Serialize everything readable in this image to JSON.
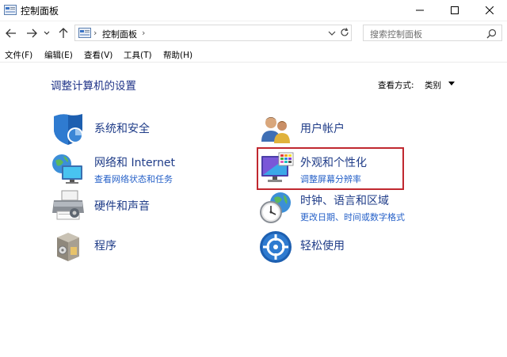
{
  "window": {
    "title": "控制面板"
  },
  "address": {
    "path": "控制面板"
  },
  "search": {
    "placeholder": "搜索控制面板"
  },
  "menu": {
    "file": "文件(F)",
    "edit": "编辑(E)",
    "view": "查看(V)",
    "tools": "工具(T)",
    "help": "帮助(H)"
  },
  "page": {
    "title": "调整计算机的设置",
    "view_by_label": "查看方式:",
    "view_by_value": "类别"
  },
  "categories": {
    "system_security": {
      "title": "系统和安全",
      "icon": "shield-icon"
    },
    "network": {
      "title": "网络和 Internet",
      "link": "查看网络状态和任务",
      "icon": "network-globe-icon"
    },
    "hardware": {
      "title": "硬件和声音",
      "icon": "printer-icon"
    },
    "programs": {
      "title": "程序",
      "icon": "programs-box-icon"
    },
    "user_accounts": {
      "title": "用户帐户",
      "icon": "users-icon"
    },
    "appearance": {
      "title": "外观和个性化",
      "link": "调整屏幕分辨率",
      "icon": "display-palette-icon",
      "highlighted": true
    },
    "clock_region": {
      "title": "时钟、语言和区域",
      "link": "更改日期、时间或数字格式",
      "icon": "clock-globe-icon"
    },
    "ease_of_access": {
      "title": "轻松使用",
      "icon": "ease-of-access-icon"
    }
  },
  "colors": {
    "title_blue": "#1e3287",
    "link_blue": "#2560c8",
    "highlight_red": "#c0282f"
  }
}
